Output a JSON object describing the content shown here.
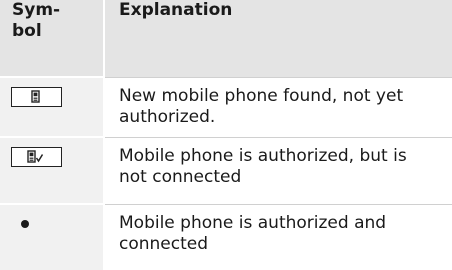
{
  "table": {
    "header": {
      "symbol": "Sym-\nbol",
      "explanation": "Explanation"
    },
    "rows": [
      {
        "symbol_icon": "phone-in-box-icon",
        "explanation": "New mobile phone found, not yet authorized."
      },
      {
        "symbol_icon": "phone-with-checkmark-in-box-icon",
        "explanation": "Mobile phone is authorized, but is not connected"
      },
      {
        "symbol_icon": "filled-dot-icon",
        "explanation": "Mobile phone is authorized and connected"
      }
    ]
  }
}
